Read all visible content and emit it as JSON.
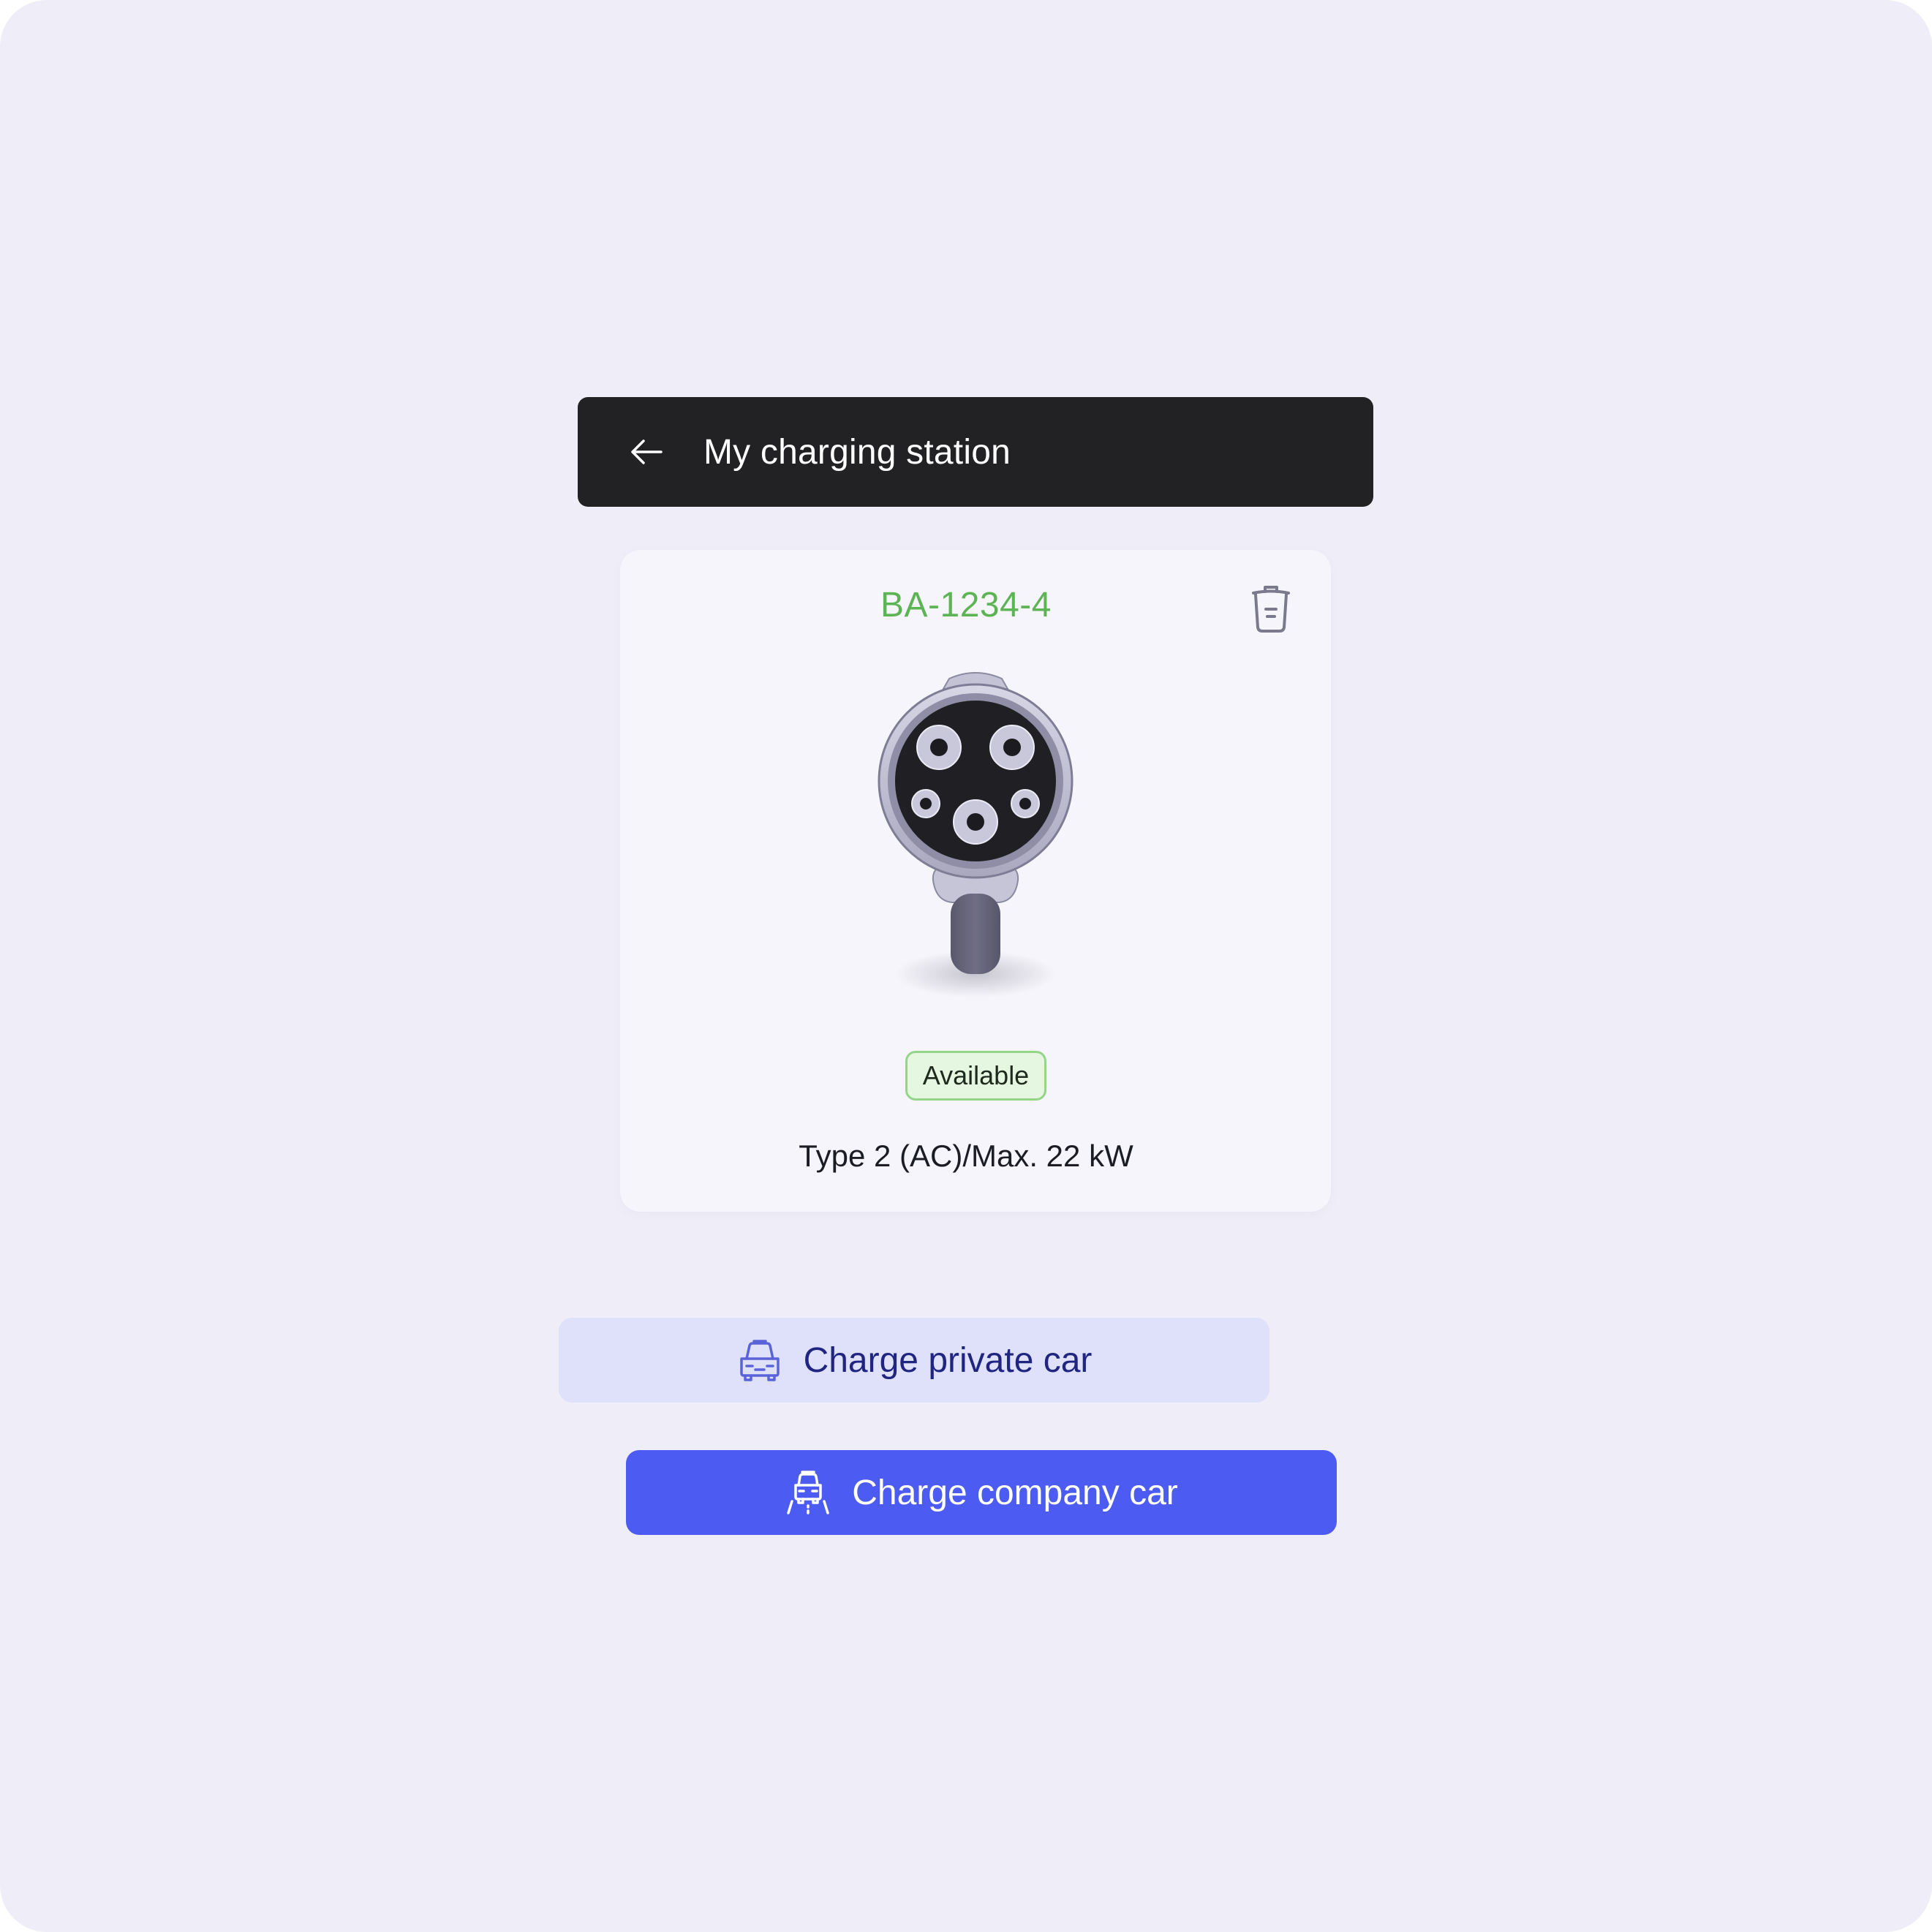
{
  "header": {
    "back_icon": "arrow-left-icon",
    "title": "My charging station"
  },
  "station": {
    "id": "BA-1234-4",
    "delete_icon": "trash-icon",
    "connector_image": "type-2-connector-plug",
    "status": "Available",
    "connector_info": "Type 2 (AC)/Max. 22 kW"
  },
  "actions": {
    "private": {
      "label": "Charge private car",
      "icon": "car-icon"
    },
    "company": {
      "label": "Charge company car",
      "icon": "car-on-road-icon"
    }
  },
  "colors": {
    "background": "#efeef8",
    "header_bg": "#222224",
    "station_id": "#5cb454",
    "status_bg": "#e6f7e1",
    "status_border": "#94d58a",
    "private_button_bg": "#dfe0fa",
    "private_button_text": "#1f2580",
    "company_button_bg": "#4c5cf2",
    "company_button_text": "#ffffff"
  }
}
